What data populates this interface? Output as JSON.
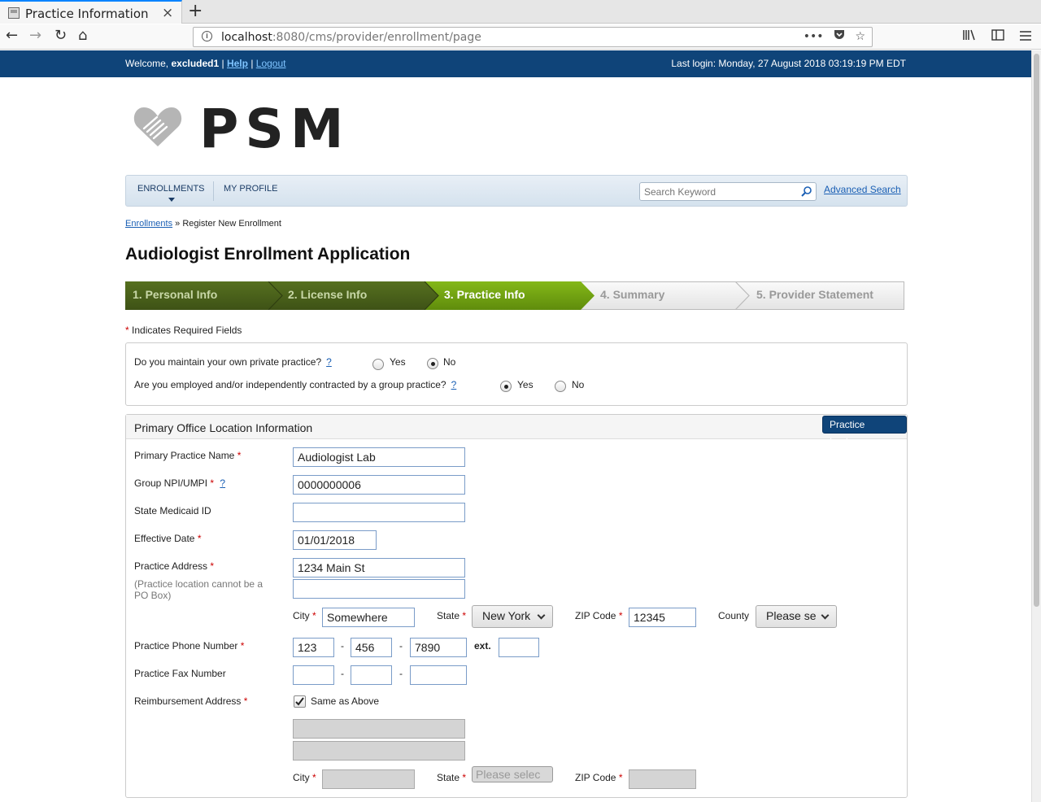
{
  "browser": {
    "tab_title": "Practice Information",
    "tab_close": "×",
    "new_tab": "+",
    "url_host": "localhost",
    "url_path": ":8080/cms/provider/enrollment/page",
    "nav_back": "←",
    "nav_forward": "→",
    "nav_reload": "↻",
    "nav_home": "⌂",
    "url_more": "•••"
  },
  "topbar": {
    "welcome_prefix": "Welcome, ",
    "username": "excluded1",
    "sep1": " | ",
    "help": "Help",
    "sep2": " | ",
    "logout": "Logout",
    "last_login": "Last login: Monday, 27 August 2018 03:19:19 PM EDT"
  },
  "logo": {
    "text": "PSM"
  },
  "menu": {
    "enrollments": "ENROLLMENTS",
    "my_profile": "MY PROFILE",
    "search_placeholder": "Search Keyword",
    "advanced_search": "Advanced Search"
  },
  "breadcrumb": {
    "link": "Enrollments",
    "sep": " » ",
    "current": "Register New Enrollment"
  },
  "page_title": "Audiologist Enrollment Application",
  "steps": [
    {
      "label": "1. Personal Info",
      "state": "done"
    },
    {
      "label": "2. License Info",
      "state": "done"
    },
    {
      "label": "3. Practice Info",
      "state": "current"
    },
    {
      "label": "4. Summary",
      "state": "todo"
    },
    {
      "label": "5. Provider Statement",
      "state": "todo"
    }
  ],
  "required_note": {
    "star": "*",
    "text": " Indicates Required Fields"
  },
  "questions": {
    "private_practice": "Do you maintain your own private practice?",
    "group_practice": "Are you employed and/or independently contracted by a group practice?",
    "help": "?",
    "yes": "Yes",
    "no": "No",
    "private_answer": "No",
    "group_answer": "Yes"
  },
  "panel": {
    "title": "Primary Office Location Information",
    "lookup": "Practice Lookup",
    "star": "*",
    "help": "?",
    "fields": {
      "practice_name_label": "Primary Practice Name",
      "practice_name": "Audiologist Lab",
      "group_npi_label": "Group NPI/UMPI",
      "group_npi": "0000000006",
      "medicaid_label": "State Medicaid ID",
      "medicaid": "",
      "effective_label": "Effective Date",
      "effective": "01/01/2018",
      "address_label": "Practice Address",
      "address_hint": "(Practice location cannot be a PO Box)",
      "address1": "1234 Main St",
      "address2": "",
      "city_label": "City",
      "city": "Somewhere",
      "state_label": "State",
      "state": "New York",
      "zip_label": "ZIP Code",
      "zip": "12345",
      "county_label": "County",
      "county": "Please se",
      "phone_label": "Practice Phone Number",
      "phone1": "123",
      "phone2": "456",
      "phone3": "7890",
      "ext_label": "ext.",
      "ext": "",
      "fax_label": "Practice Fax Number",
      "fax1": "",
      "fax2": "",
      "fax3": "",
      "dash": "-",
      "reimb_label": "Reimbursement Address",
      "same_as_above": "Same as Above",
      "reimb_city_label": "City",
      "reimb_state_label": "State",
      "reimb_state": "Please selec",
      "reimb_zip_label": "ZIP Code"
    }
  },
  "colors": {
    "topbar": "#0f4479",
    "step_done": "#4a5e1c",
    "step_current": "#74a212",
    "step_todo": "#f0f0f0",
    "required": "#cc0000",
    "link": "#1a5fb4"
  }
}
